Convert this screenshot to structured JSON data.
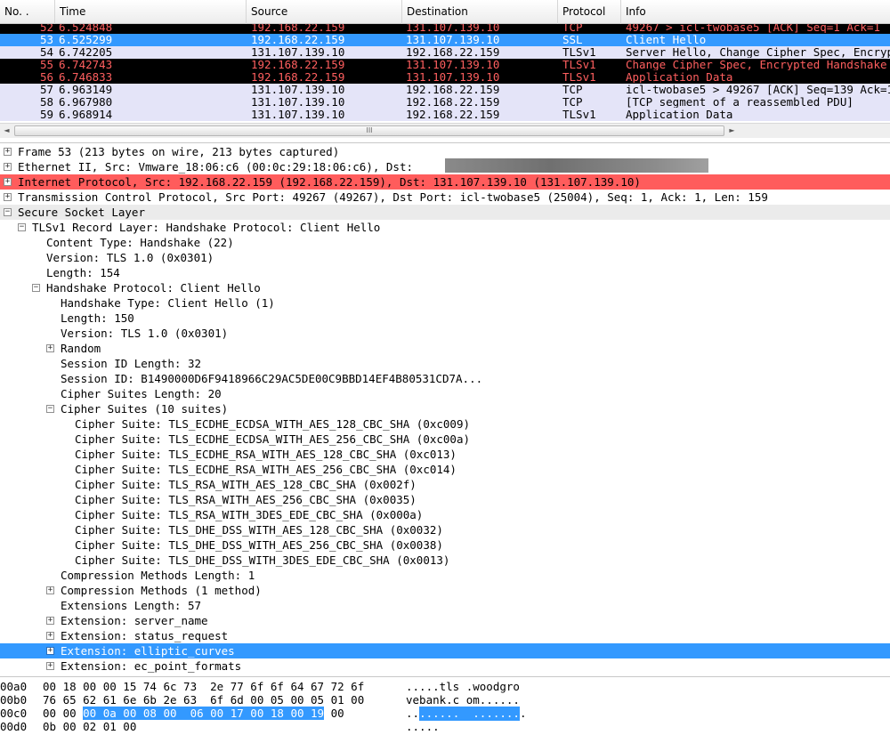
{
  "columns": [
    "No. .",
    "Time",
    "Source",
    "Destination",
    "Protocol",
    "Info"
  ],
  "packets": [
    {
      "no": "52",
      "time": "6.524848",
      "src": "192.168.22.159",
      "dst": "131.107.139.10",
      "proto": "TCP",
      "info": "49267 > icl-twobase5 [ACK] Seq=1 Ack=1",
      "style": "dark"
    },
    {
      "no": "53",
      "time": "6.525299",
      "src": "192.168.22.159",
      "dst": "131.107.139.10",
      "proto": "SSL",
      "info": "Client Hello",
      "style": "selected"
    },
    {
      "no": "54",
      "time": "6.742205",
      "src": "131.107.139.10",
      "dst": "192.168.22.159",
      "proto": "TLSv1",
      "info": "Server Hello, Change Cipher Spec, Encrypted Handshake Message",
      "style": "light"
    },
    {
      "no": "55",
      "time": "6.742743",
      "src": "192.168.22.159",
      "dst": "131.107.139.10",
      "proto": "TLSv1",
      "info": "Change Cipher Spec, Encrypted Handshake Message",
      "style": "dark"
    },
    {
      "no": "56",
      "time": "6.746833",
      "src": "192.168.22.159",
      "dst": "131.107.139.10",
      "proto": "TLSv1",
      "info": "Application Data",
      "style": "dark"
    },
    {
      "no": "57",
      "time": "6.963149",
      "src": "131.107.139.10",
      "dst": "192.168.22.159",
      "proto": "TCP",
      "info": "icl-twobase5 > 49267 [ACK] Seq=139 Ack=160",
      "style": "light"
    },
    {
      "no": "58",
      "time": "6.967980",
      "src": "131.107.139.10",
      "dst": "192.168.22.159",
      "proto": "TCP",
      "info": "[TCP segment of a reassembled PDU]",
      "style": "light"
    },
    {
      "no": "59",
      "time": "6.968914",
      "src": "131.107.139.10",
      "dst": "192.168.22.159",
      "proto": "TLSv1",
      "info": "Application Data",
      "style": "light"
    }
  ],
  "scrollbar": {
    "left_arrow": "◄",
    "right_arrow": "►",
    "grip": "III"
  },
  "tree": [
    {
      "level": 0,
      "exp": "+",
      "text": "Frame 53 (213 bytes on wire, 213 bytes captured)",
      "style": ""
    },
    {
      "level": 0,
      "exp": "+",
      "text": "Ethernet II, Src: Vmware_18:06:c6 (00:0c:29:18:06:c6), Dst:",
      "style": ""
    },
    {
      "level": 0,
      "exp": "+",
      "text": "Internet Protocol, Src: 192.168.22.159 (192.168.22.159), Dst: 131.107.139.10 (131.107.139.10)",
      "style": "red"
    },
    {
      "level": 0,
      "exp": "+",
      "text": "Transmission Control Protocol, Src Port: 49267 (49267), Dst Port: icl-twobase5 (25004), Seq: 1, Ack: 1, Len: 159",
      "style": ""
    },
    {
      "level": 0,
      "exp": "-",
      "text": "Secure Socket Layer",
      "style": "gray"
    },
    {
      "level": 1,
      "exp": "-",
      "text": "TLSv1 Record Layer: Handshake Protocol: Client Hello",
      "style": ""
    },
    {
      "level": 2,
      "exp": "",
      "text": "Content Type: Handshake (22)",
      "style": ""
    },
    {
      "level": 2,
      "exp": "",
      "text": "Version: TLS 1.0 (0x0301)",
      "style": ""
    },
    {
      "level": 2,
      "exp": "",
      "text": "Length: 154",
      "style": ""
    },
    {
      "level": 2,
      "exp": "-",
      "text": "Handshake Protocol: Client Hello",
      "style": ""
    },
    {
      "level": 3,
      "exp": "",
      "text": "Handshake Type: Client Hello (1)",
      "style": ""
    },
    {
      "level": 3,
      "exp": "",
      "text": "Length: 150",
      "style": ""
    },
    {
      "level": 3,
      "exp": "",
      "text": "Version: TLS 1.0 (0x0301)",
      "style": ""
    },
    {
      "level": 3,
      "exp": "+",
      "text": "Random",
      "style": ""
    },
    {
      "level": 3,
      "exp": "",
      "text": "Session ID Length: 32",
      "style": ""
    },
    {
      "level": 3,
      "exp": "",
      "text": "Session ID: B1490000D6F9418966C29AC5DE00C9BBD14EF4B80531CD7A...",
      "style": ""
    },
    {
      "level": 3,
      "exp": "",
      "text": "Cipher Suites Length: 20",
      "style": ""
    },
    {
      "level": 3,
      "exp": "-",
      "text": "Cipher Suites (10 suites)",
      "style": ""
    },
    {
      "level": 4,
      "exp": "",
      "text": "Cipher Suite: TLS_ECDHE_ECDSA_WITH_AES_128_CBC_SHA (0xc009)",
      "style": ""
    },
    {
      "level": 4,
      "exp": "",
      "text": "Cipher Suite: TLS_ECDHE_ECDSA_WITH_AES_256_CBC_SHA (0xc00a)",
      "style": ""
    },
    {
      "level": 4,
      "exp": "",
      "text": "Cipher Suite: TLS_ECDHE_RSA_WITH_AES_128_CBC_SHA (0xc013)",
      "style": ""
    },
    {
      "level": 4,
      "exp": "",
      "text": "Cipher Suite: TLS_ECDHE_RSA_WITH_AES_256_CBC_SHA (0xc014)",
      "style": ""
    },
    {
      "level": 4,
      "exp": "",
      "text": "Cipher Suite: TLS_RSA_WITH_AES_128_CBC_SHA (0x002f)",
      "style": ""
    },
    {
      "level": 4,
      "exp": "",
      "text": "Cipher Suite: TLS_RSA_WITH_AES_256_CBC_SHA (0x0035)",
      "style": ""
    },
    {
      "level": 4,
      "exp": "",
      "text": "Cipher Suite: TLS_RSA_WITH_3DES_EDE_CBC_SHA (0x000a)",
      "style": ""
    },
    {
      "level": 4,
      "exp": "",
      "text": "Cipher Suite: TLS_DHE_DSS_WITH_AES_128_CBC_SHA (0x0032)",
      "style": ""
    },
    {
      "level": 4,
      "exp": "",
      "text": "Cipher Suite: TLS_DHE_DSS_WITH_AES_256_CBC_SHA (0x0038)",
      "style": ""
    },
    {
      "level": 4,
      "exp": "",
      "text": "Cipher Suite: TLS_DHE_DSS_WITH_3DES_EDE_CBC_SHA (0x0013)",
      "style": ""
    },
    {
      "level": 3,
      "exp": "",
      "text": "Compression Methods Length: 1",
      "style": ""
    },
    {
      "level": 3,
      "exp": "+",
      "text": "Compression Methods (1 method)",
      "style": ""
    },
    {
      "level": 3,
      "exp": "",
      "text": "Extensions Length: 57",
      "style": ""
    },
    {
      "level": 3,
      "exp": "+",
      "text": "Extension: server_name",
      "style": ""
    },
    {
      "level": 3,
      "exp": "+",
      "text": "Extension: status_request",
      "style": ""
    },
    {
      "level": 3,
      "exp": "+",
      "text": "Extension: elliptic_curves",
      "style": "sel"
    },
    {
      "level": 3,
      "exp": "+",
      "text": "Extension: ec_point_formats",
      "style": ""
    }
  ],
  "hex": [
    {
      "offset": "00a0",
      "bytes_pre": "00 18 00 00 15 74 6c 73  2e 77 6f 6f 64 67 72 6f",
      "bytes_hl": "",
      "bytes_post": "",
      "ascii_pre": ".....tls .woodgro",
      "ascii_hl": "",
      "ascii_post": ""
    },
    {
      "offset": "00b0",
      "bytes_pre": "76 65 62 61 6e 6b 2e 63  6f 6d 00 05 00 05 01 00",
      "bytes_hl": "",
      "bytes_post": "",
      "ascii_pre": "vebank.c om......",
      "ascii_hl": "",
      "ascii_post": ""
    },
    {
      "offset": "00c0",
      "bytes_pre": "00 00 ",
      "bytes_hl": "00 0a 00 08 00  06 00 17 00 18 00 19",
      "bytes_post": " 00",
      "ascii_pre": "..",
      "ascii_hl": "......  .......",
      "ascii_post": "."
    },
    {
      "offset": "00d0",
      "bytes_pre": "0b 00 02 01 00",
      "bytes_hl": "",
      "bytes_post": "",
      "ascii_pre": ".....",
      "ascii_hl": "",
      "ascii_post": ""
    }
  ]
}
